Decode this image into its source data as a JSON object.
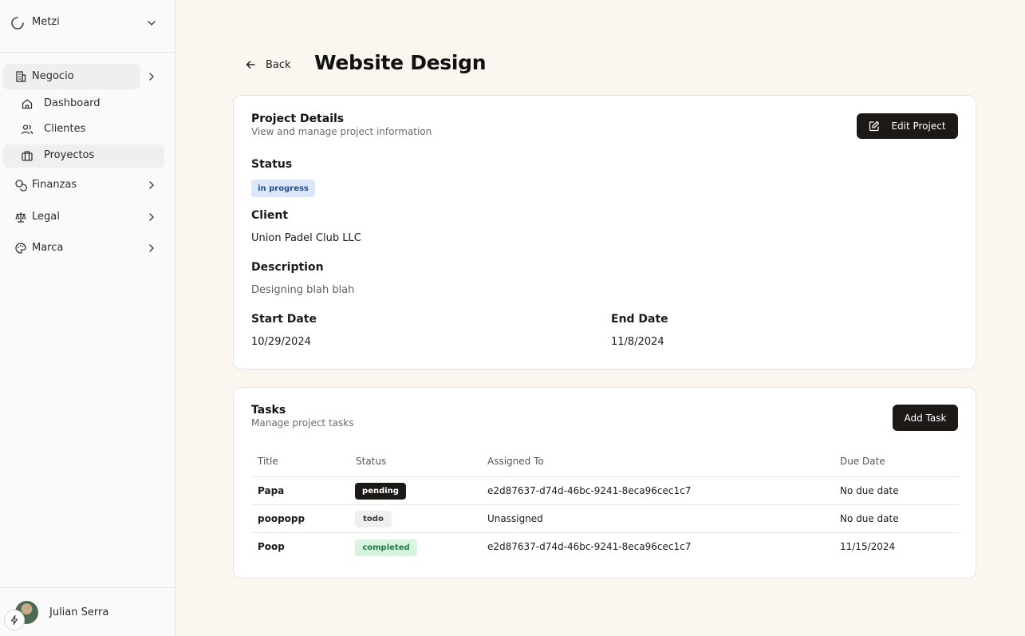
{
  "sidebar": {
    "workspace": "Metzi",
    "groups": [
      {
        "label": "Negocio",
        "icon": "building-icon"
      },
      {
        "label": "Finanzas",
        "icon": "coins-icon"
      },
      {
        "label": "Legal",
        "icon": "scale-icon"
      },
      {
        "label": "Marca",
        "icon": "palette-icon"
      }
    ],
    "sub_items": [
      {
        "label": "Dashboard",
        "icon": "home-icon"
      },
      {
        "label": "Clientes",
        "icon": "users-icon"
      },
      {
        "label": "Proyectos",
        "icon": "briefcase-icon",
        "active": true
      }
    ],
    "user_name": "Julian Serra"
  },
  "header": {
    "back_label": "Back",
    "title": "Website Design"
  },
  "project": {
    "title": "Project Details",
    "subtitle": "View and manage project information",
    "edit_label": "Edit Project",
    "status_label": "Status",
    "status_value": "in progress",
    "client_label": "Client",
    "client_value": "Union Padel Club LLC",
    "description_label": "Description",
    "description_value": "Designing blah blah",
    "start_label": "Start Date",
    "start_value": "10/29/2024",
    "end_label": "End Date",
    "end_value": "11/8/2024"
  },
  "tasks": {
    "title": "Tasks",
    "subtitle": "Manage project tasks",
    "add_label": "Add Task",
    "columns": [
      "Title",
      "Status",
      "Assigned To",
      "Due Date"
    ],
    "rows": [
      {
        "title": "Papa",
        "status": "pending",
        "assigned": "e2d87637-d74d-46bc-9241-8eca96cec1c7",
        "due": "No due date"
      },
      {
        "title": "poopopp",
        "status": "todo",
        "assigned": "Unassigned",
        "due": "No due date"
      },
      {
        "title": "Poop",
        "status": "completed",
        "assigned": "e2d87637-d74d-46bc-9241-8eca96cec1c7",
        "due": "11/15/2024"
      }
    ]
  },
  "colors": {
    "page_bg": "#fcf6f1",
    "sidebar_bg": "#fafafa",
    "primary_button": "#1c1917",
    "badge_progress": "#dbe7fb",
    "badge_completed": "#d9f3e2"
  }
}
